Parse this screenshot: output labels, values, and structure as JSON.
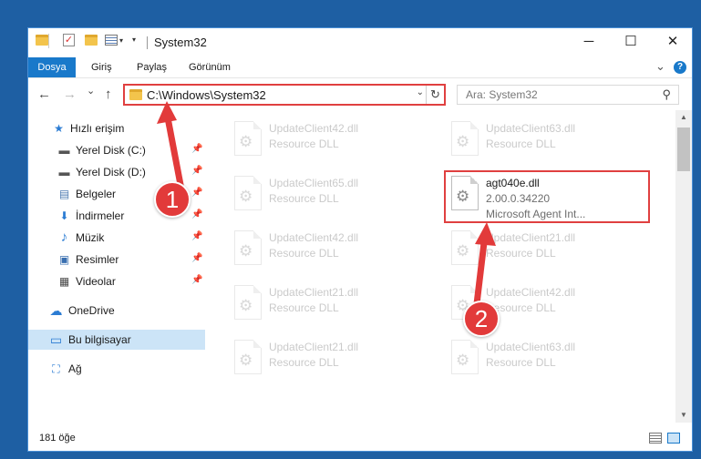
{
  "window": {
    "title": "System32",
    "quick_access_dropdown": "▾",
    "controls": {
      "minimize": "─",
      "maximize": "☐",
      "close": "✕"
    }
  },
  "ribbon": {
    "tabs": [
      {
        "label": "Dosya",
        "active": true
      },
      {
        "label": "Giriş",
        "active": false
      },
      {
        "label": "Paylaş",
        "active": false
      },
      {
        "label": "Görünüm",
        "active": false
      }
    ],
    "collapse_glyph": "⌄",
    "help_glyph": "?"
  },
  "navigation": {
    "back_glyph": "←",
    "forward_glyph": "→",
    "recent_glyph": "⌄",
    "up_glyph": "↑",
    "address": "C:\\Windows\\System32",
    "address_dropdown_glyph": "⌄",
    "refresh_glyph": "↻",
    "search_placeholder": "Ara: System32",
    "search_glyph": "⚲"
  },
  "nav_pane": {
    "items": [
      {
        "label": "Hızlı erişim",
        "icon": "star-icon",
        "glyph": "★",
        "color": "#2b7cd3",
        "pinned": false
      },
      {
        "label": "Yerel Disk (C:)",
        "icon": "drive-icon",
        "glyph": "▬",
        "color": "#555555",
        "pinned": true
      },
      {
        "label": "Yerel Disk (D:)",
        "icon": "drive-icon",
        "glyph": "▬",
        "color": "#555555",
        "pinned": true
      },
      {
        "label": "Belgeler",
        "icon": "documents-icon",
        "glyph": "▤",
        "color": "#4a78b0",
        "pinned": true
      },
      {
        "label": "İndirmeler",
        "icon": "download-icon",
        "glyph": "⬇",
        "color": "#2b7cd3",
        "pinned": true
      },
      {
        "label": "Müzik",
        "icon": "music-icon",
        "glyph": "♪",
        "color": "#2b7cd3",
        "pinned": true
      },
      {
        "label": "Resimler",
        "icon": "pictures-icon",
        "glyph": "▣",
        "color": "#3a6fb0",
        "pinned": true
      },
      {
        "label": "Videolar",
        "icon": "video-icon",
        "glyph": "▦",
        "color": "#444444",
        "pinned": true
      },
      {
        "label": "OneDrive",
        "icon": "cloud-icon",
        "glyph": "☁",
        "color": "#2b7cd3",
        "pinned": false
      },
      {
        "label": "Bu bilgisayar",
        "icon": "computer-icon",
        "glyph": "▭",
        "color": "#2b7cd3",
        "pinned": false,
        "selected": true
      },
      {
        "label": "Ağ",
        "icon": "network-icon",
        "glyph": "⛶",
        "color": "#2b7cd3",
        "pinned": false
      }
    ],
    "pin_glyph": "📌"
  },
  "files": [
    {
      "name": "UpdateClient42.dll",
      "type": "Resource DLL"
    },
    {
      "name": "UpdateClient63.dll",
      "type": "Resource DLL"
    },
    {
      "name": "UpdateClient65.dll",
      "type": "Resource DLL"
    },
    {
      "name": "agt040e.dll",
      "version": "2.00.0.34220",
      "company": "Microsoft Agent Int...",
      "highlighted": true
    },
    {
      "name": "UpdateClient42.dll",
      "type": "Resource DLL"
    },
    {
      "name": "UpdateClient21.dll",
      "type": "Resource DLL"
    },
    {
      "name": "UpdateClient21.dll",
      "type": "Resource DLL"
    },
    {
      "name": "UpdateClient42.dll",
      "type": "Resource DLL"
    },
    {
      "name": "UpdateClient21.dll",
      "type": "Resource DLL"
    },
    {
      "name": "UpdateClient63.dll",
      "type": "Resource DLL"
    }
  ],
  "status": {
    "item_count": "181 öğe"
  },
  "annotations": {
    "step1": "1",
    "step2": "2",
    "accent": "#e04040"
  },
  "colors": {
    "accent": "#1979ca",
    "selection": "#cce4f7",
    "highlight": "#e04040"
  }
}
